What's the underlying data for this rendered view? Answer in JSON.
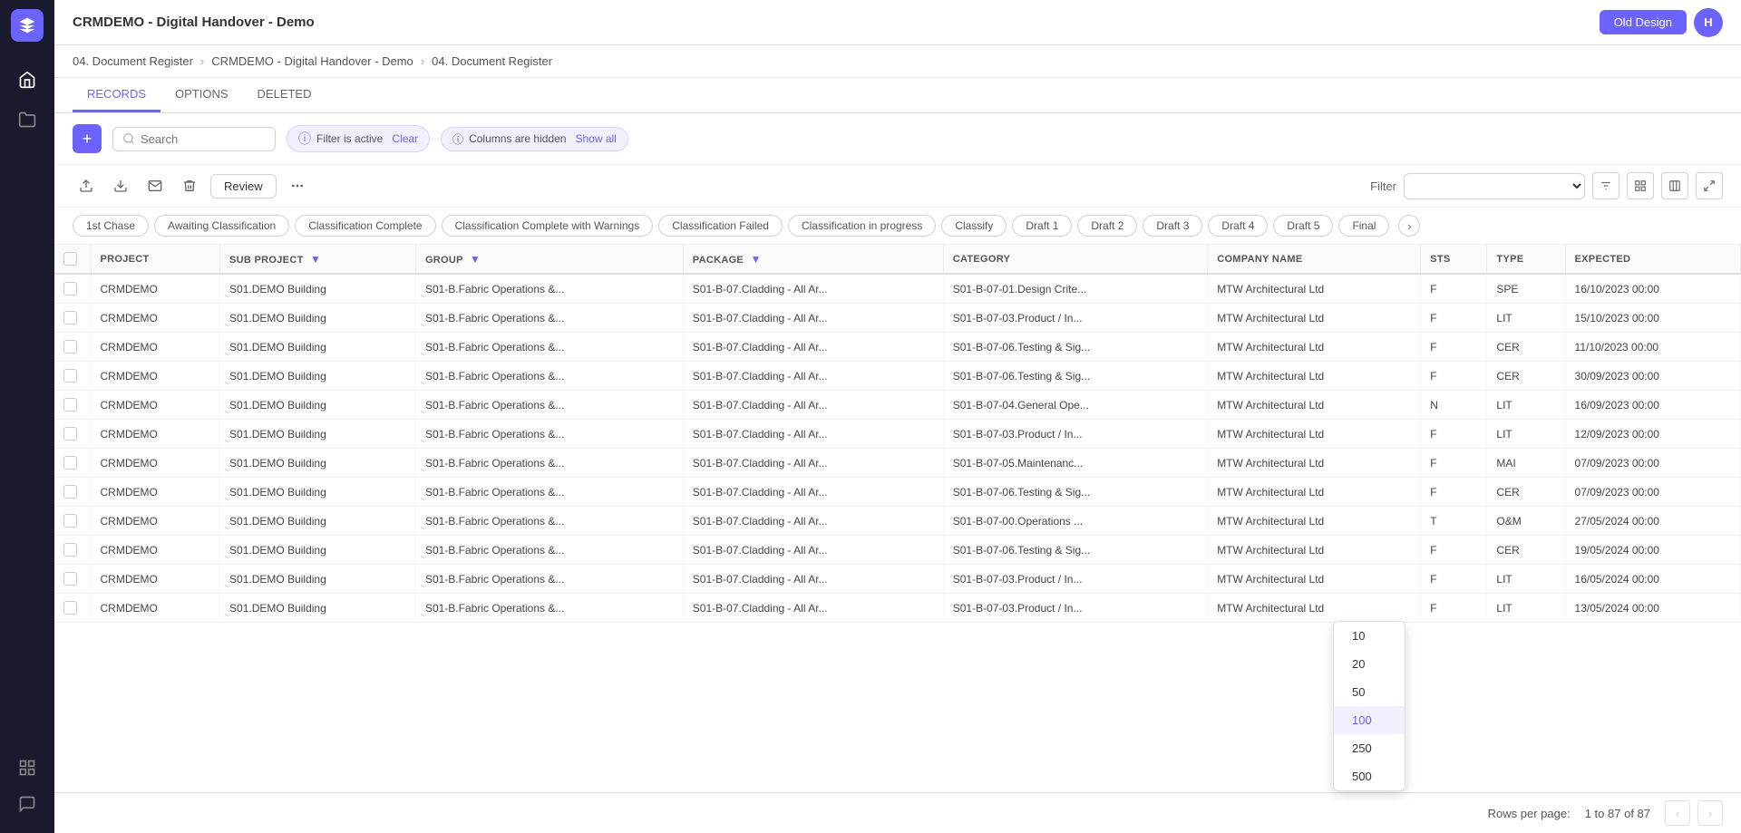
{
  "app": {
    "title": "CRMDEMO - Digital Handover - Demo",
    "old_design_btn": "Old Design",
    "avatar_initials": "H"
  },
  "breadcrumb": {
    "module": "04. Document Register",
    "project": "CRMDEMO - Digital Handover - Demo",
    "current": "04. Document Register"
  },
  "tabs": [
    {
      "id": "records",
      "label": "RECORDS",
      "active": true
    },
    {
      "id": "options",
      "label": "OPTIONS",
      "active": false
    },
    {
      "id": "deleted",
      "label": "DELETED",
      "active": false
    }
  ],
  "toolbar": {
    "search_placeholder": "Search",
    "filter_active_label": "Filter is active",
    "clear_label": "Clear",
    "columns_hidden_label": "Columns are hidden",
    "show_all_label": "Show all"
  },
  "action_bar": {
    "review_btn": "Review",
    "filter_label": "Filter",
    "filter_placeholder": ""
  },
  "status_pills": [
    "1st Chase",
    "Awaiting Classification",
    "Classification Complete",
    "Classification Complete with Warnings",
    "Classification Failed",
    "Classification in progress",
    "Classify",
    "Draft 1",
    "Draft 2",
    "Draft 3",
    "Draft 4",
    "Draft 5",
    "Final"
  ],
  "table": {
    "columns": [
      {
        "id": "check",
        "label": ""
      },
      {
        "id": "project",
        "label": "PROJECT"
      },
      {
        "id": "sub_project",
        "label": "SUB PROJECT",
        "has_filter": true
      },
      {
        "id": "group",
        "label": "GROUP",
        "has_filter": true
      },
      {
        "id": "package",
        "label": "PACKAGE",
        "has_filter": true
      },
      {
        "id": "category",
        "label": "CATEGORY"
      },
      {
        "id": "company_name",
        "label": "COMPANY NAME"
      },
      {
        "id": "sts",
        "label": "STS"
      },
      {
        "id": "type",
        "label": "TYPE"
      },
      {
        "id": "expected",
        "label": "EXPECTED"
      }
    ],
    "rows": [
      {
        "project": "CRMDEMO",
        "sub_project": "S01.DEMO Building",
        "group": "S01-B.Fabric Operations &...",
        "package": "S01-B-07.Cladding - All Ar...",
        "category": "S01-B-07-01.Design Crite...",
        "company_name": "MTW Architectural Ltd",
        "sts": "F",
        "type": "SPE",
        "expected": "16/10/2023 00:00"
      },
      {
        "project": "CRMDEMO",
        "sub_project": "S01.DEMO Building",
        "group": "S01-B.Fabric Operations &...",
        "package": "S01-B-07.Cladding - All Ar...",
        "category": "S01-B-07-03.Product / In...",
        "company_name": "MTW Architectural Ltd",
        "sts": "F",
        "type": "LIT",
        "expected": "15/10/2023 00:00"
      },
      {
        "project": "CRMDEMO",
        "sub_project": "S01.DEMO Building",
        "group": "S01-B.Fabric Operations &...",
        "package": "S01-B-07.Cladding - All Ar...",
        "category": "S01-B-07-06.Testing & Sig...",
        "company_name": "MTW Architectural Ltd",
        "sts": "F",
        "type": "CER",
        "expected": "11/10/2023 00:00"
      },
      {
        "project": "CRMDEMO",
        "sub_project": "S01.DEMO Building",
        "group": "S01-B.Fabric Operations &...",
        "package": "S01-B-07.Cladding - All Ar...",
        "category": "S01-B-07-06.Testing & Sig...",
        "company_name": "MTW Architectural Ltd",
        "sts": "F",
        "type": "CER",
        "expected": "30/09/2023 00:00"
      },
      {
        "project": "CRMDEMO",
        "sub_project": "S01.DEMO Building",
        "group": "S01-B.Fabric Operations &...",
        "package": "S01-B-07.Cladding - All Ar...",
        "category": "S01-B-07-04.General Ope...",
        "company_name": "MTW Architectural Ltd",
        "sts": "N",
        "type": "LIT",
        "expected": "16/09/2023 00:00"
      },
      {
        "project": "CRMDEMO",
        "sub_project": "S01.DEMO Building",
        "group": "S01-B.Fabric Operations &...",
        "package": "S01-B-07.Cladding - All Ar...",
        "category": "S01-B-07-03.Product / In...",
        "company_name": "MTW Architectural Ltd",
        "sts": "F",
        "type": "LIT",
        "expected": "12/09/2023 00:00"
      },
      {
        "project": "CRMDEMO",
        "sub_project": "S01.DEMO Building",
        "group": "S01-B.Fabric Operations &...",
        "package": "S01-B-07.Cladding - All Ar...",
        "category": "S01-B-07-05.Maintenanc...",
        "company_name": "MTW Architectural Ltd",
        "sts": "F",
        "type": "MAI",
        "expected": "07/09/2023 00:00"
      },
      {
        "project": "CRMDEMO",
        "sub_project": "S01.DEMO Building",
        "group": "S01-B.Fabric Operations &...",
        "package": "S01-B-07.Cladding - All Ar...",
        "category": "S01-B-07-06.Testing & Sig...",
        "company_name": "MTW Architectural Ltd",
        "sts": "F",
        "type": "CER",
        "expected": "07/09/2023 00:00"
      },
      {
        "project": "CRMDEMO",
        "sub_project": "S01.DEMO Building",
        "group": "S01-B.Fabric Operations &...",
        "package": "S01-B-07.Cladding - All Ar...",
        "category": "S01-B-07-00.Operations ...",
        "company_name": "MTW Architectural Ltd",
        "sts": "T",
        "type": "O&M",
        "expected": "27/05/2024 00:00"
      },
      {
        "project": "CRMDEMO",
        "sub_project": "S01.DEMO Building",
        "group": "S01-B.Fabric Operations &...",
        "package": "S01-B-07.Cladding - All Ar...",
        "category": "S01-B-07-06.Testing & Sig...",
        "company_name": "MTW Architectural Ltd",
        "sts": "F",
        "type": "CER",
        "expected": "19/05/2024 00:00"
      },
      {
        "project": "CRMDEMO",
        "sub_project": "S01.DEMO Building",
        "group": "S01-B.Fabric Operations &...",
        "package": "S01-B-07.Cladding - All Ar...",
        "category": "S01-B-07-03.Product / In...",
        "company_name": "MTW Architectural Ltd",
        "sts": "F",
        "type": "LIT",
        "expected": "16/05/2024 00:00"
      },
      {
        "project": "CRMDEMO",
        "sub_project": "S01.DEMO Building",
        "group": "S01-B.Fabric Operations &...",
        "package": "S01-B-07.Cladding - All Ar...",
        "category": "S01-B-07-03.Product / In...",
        "company_name": "MTW Architectural Ltd",
        "sts": "F",
        "type": "LIT",
        "expected": "13/05/2024 00:00"
      }
    ]
  },
  "footer": {
    "rows_per_page_label": "Rows per page:",
    "pagination_label": "1 to 87 of 87",
    "dropdown_options": [
      {
        "value": "10",
        "label": "10"
      },
      {
        "value": "20",
        "label": "20"
      },
      {
        "value": "50",
        "label": "50"
      },
      {
        "value": "100",
        "label": "100",
        "highlighted": true
      },
      {
        "value": "250",
        "label": "250"
      },
      {
        "value": "500",
        "label": "500"
      }
    ]
  },
  "sidebar": {
    "items": [
      {
        "id": "home",
        "icon": "home"
      },
      {
        "id": "folder",
        "icon": "folder"
      },
      {
        "id": "dashboard",
        "icon": "dashboard"
      },
      {
        "id": "chat",
        "icon": "chat"
      }
    ]
  }
}
